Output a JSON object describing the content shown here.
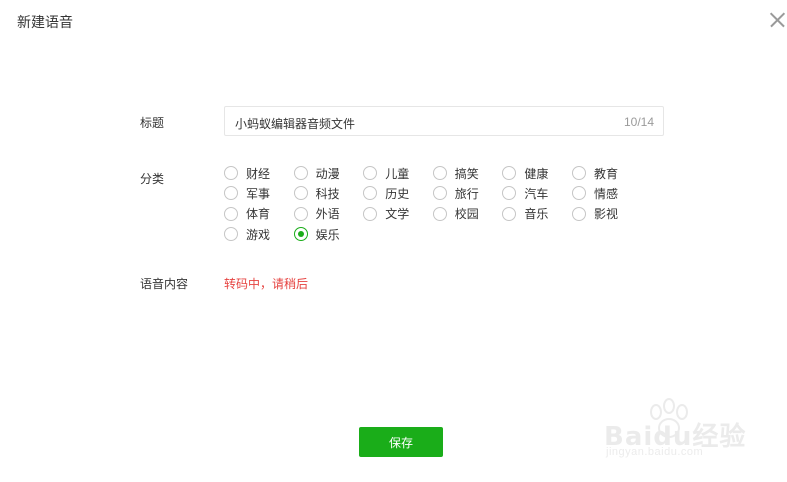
{
  "dialog": {
    "title": "新建语音"
  },
  "form": {
    "title_label": "标题",
    "title_value": "小蚂蚁编辑器音频文件",
    "title_counter": "10/14",
    "category_label": "分类",
    "categories": [
      {
        "label": "财经",
        "checked": false
      },
      {
        "label": "动漫",
        "checked": false
      },
      {
        "label": "儿童",
        "checked": false
      },
      {
        "label": "搞笑",
        "checked": false
      },
      {
        "label": "健康",
        "checked": false
      },
      {
        "label": "教育",
        "checked": false
      },
      {
        "label": "军事",
        "checked": false
      },
      {
        "label": "科技",
        "checked": false
      },
      {
        "label": "历史",
        "checked": false
      },
      {
        "label": "旅行",
        "checked": false
      },
      {
        "label": "汽车",
        "checked": false
      },
      {
        "label": "情感",
        "checked": false
      },
      {
        "label": "体育",
        "checked": false
      },
      {
        "label": "外语",
        "checked": false
      },
      {
        "label": "文学",
        "checked": false
      },
      {
        "label": "校园",
        "checked": false
      },
      {
        "label": "音乐",
        "checked": false
      },
      {
        "label": "影视",
        "checked": false
      },
      {
        "label": "游戏",
        "checked": false
      },
      {
        "label": "娱乐",
        "checked": true
      }
    ],
    "content_label": "语音内容",
    "content_status": "转码中，请稍后"
  },
  "footer": {
    "save_label": "保存"
  },
  "watermark": {
    "logo": "Baidu经验",
    "url": "jingyan.baidu.com"
  },
  "colors": {
    "accent": "#1aad19",
    "status_red": "#e64340"
  }
}
